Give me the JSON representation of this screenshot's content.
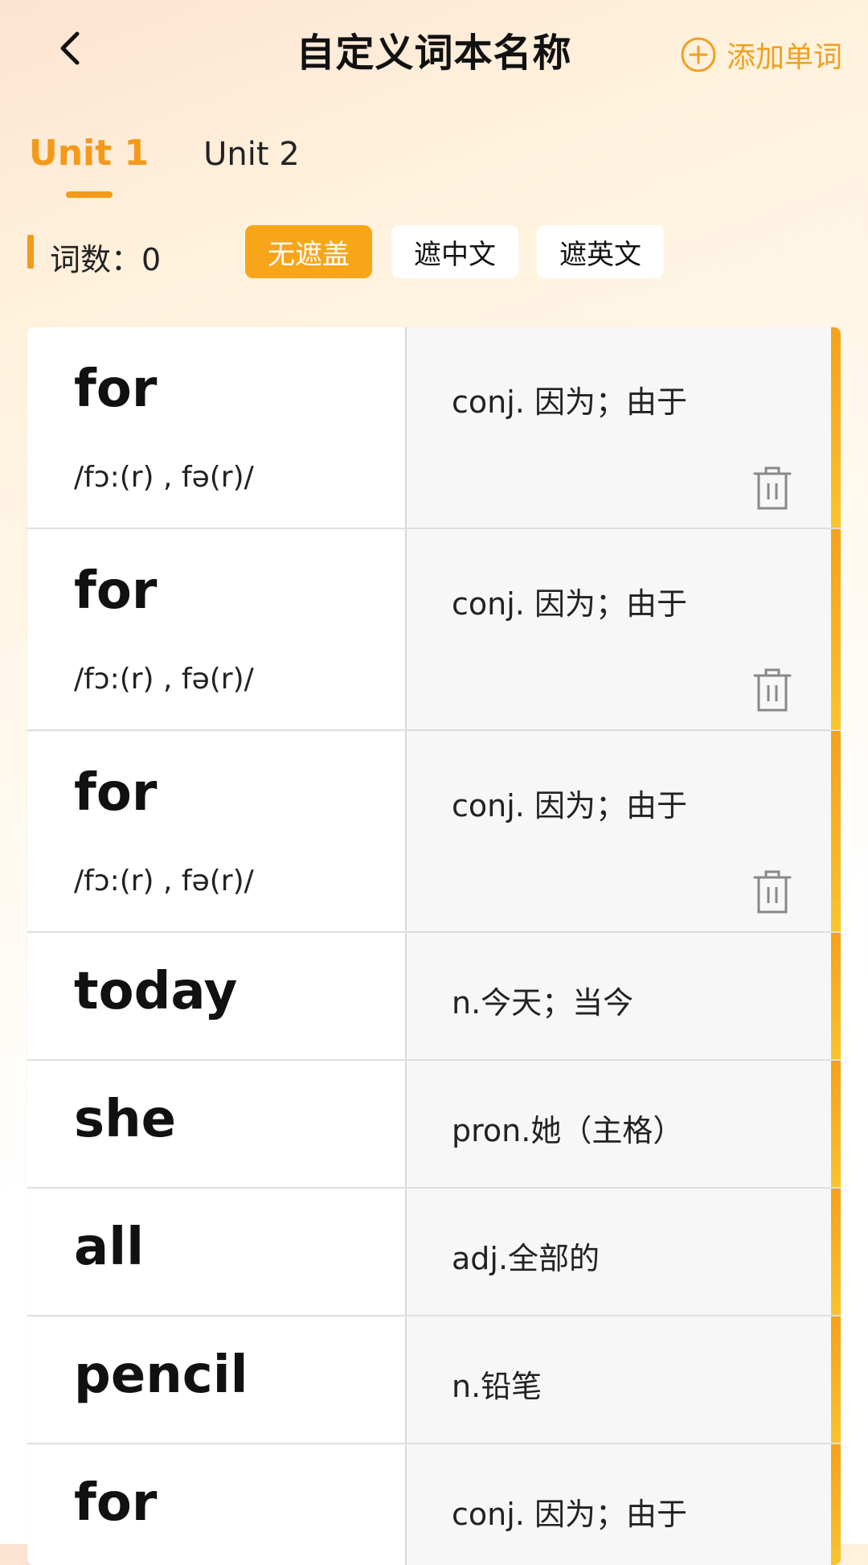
{
  "header": {
    "title": "自定义词本名称",
    "add_label": "添加单词"
  },
  "tabs": [
    {
      "label": "Unit 1",
      "active": true
    },
    {
      "label": "Unit 2",
      "active": false
    }
  ],
  "count": {
    "label": "词数：0"
  },
  "modes": [
    {
      "label": "无遮盖",
      "active": true
    },
    {
      "label": "遮中文",
      "active": false
    },
    {
      "label": "遮英文",
      "active": false
    }
  ],
  "words": [
    {
      "word": "for",
      "phonetic": "/fɔ:(r) , fə(r)/",
      "definition": "conj. 因为；由于",
      "deletable": true
    },
    {
      "word": "for",
      "phonetic": "/fɔ:(r) , fə(r)/",
      "definition": "conj. 因为；由于",
      "deletable": true
    },
    {
      "word": "for",
      "phonetic": "/fɔ:(r) , fə(r)/",
      "definition": "conj. 因为；由于",
      "deletable": true
    },
    {
      "word": "today",
      "phonetic": "",
      "definition": "n.今天；当今",
      "deletable": false
    },
    {
      "word": "she",
      "phonetic": "",
      "definition": "pron.她（主格）",
      "deletable": false
    },
    {
      "word": "all",
      "phonetic": "",
      "definition": "adj.全部的",
      "deletable": false
    },
    {
      "word": "pencil",
      "phonetic": "",
      "definition": "n.铅笔",
      "deletable": false
    },
    {
      "word": "for",
      "phonetic": "",
      "definition": "conj. 因为；由于",
      "deletable": false
    }
  ],
  "colors": {
    "accent": "#f39a1b",
    "accent_button": "#f8a519"
  },
  "icons": {
    "back": "chevron-left-icon",
    "add": "plus-circle-icon",
    "delete": "trash-icon"
  }
}
